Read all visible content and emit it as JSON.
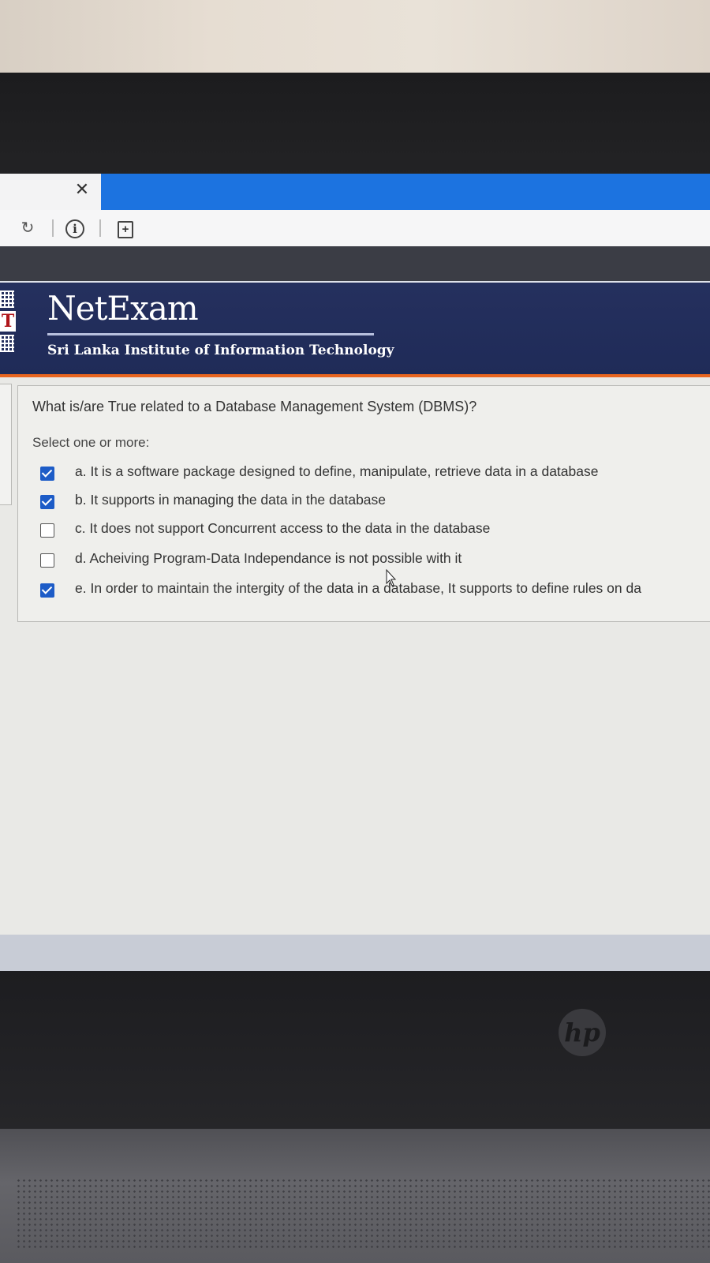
{
  "browser": {
    "tab_close_icon": "close-icon",
    "nav": {
      "refresh_icon": "refresh-icon",
      "info_glyph": "i",
      "page_icon": "add-page-icon",
      "page_glyph": "+"
    },
    "accent_color": "#1c73e0"
  },
  "site": {
    "logo_letter": "T",
    "title": "NetExam",
    "subtitle": "Sri Lanka Institute of Information Technology",
    "header_color": "#25305e",
    "accent_line_color": "#e8651f"
  },
  "question": {
    "text": "What is/are True related to a Database Management System (DBMS)?",
    "prompt": "Select one or more:",
    "answers": [
      {
        "label": "a. It is a software package designed to define, manipulate, retrieve data in a database",
        "checked": true
      },
      {
        "label": "b. It supports in managing the data in the database",
        "checked": true
      },
      {
        "label": "c. It does not support Concurrent access to the data in the database",
        "checked": false
      },
      {
        "label": "d. Acheiving Program-Data Independance is not possible with it",
        "checked": false
      },
      {
        "label": "e. In order to maintain the intergity of the data in a database, It supports to define rules on da",
        "checked": true
      }
    ]
  },
  "device": {
    "logo": "hp"
  }
}
